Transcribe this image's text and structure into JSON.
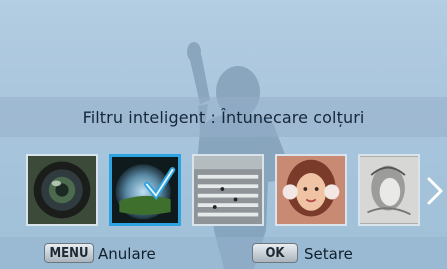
{
  "title": "Filtru inteligent : Întunecare colțuri",
  "thumbnails": [
    {
      "name": "fisheye",
      "selected": false
    },
    {
      "name": "vignette",
      "selected": true
    },
    {
      "name": "miniature",
      "selected": false
    },
    {
      "name": "soft-focus",
      "selected": false
    },
    {
      "name": "sketch",
      "selected": false
    }
  ],
  "footer": {
    "menu_key": "MENU",
    "menu_label": "Anulare",
    "ok_key": "OK",
    "ok_label": "Setare"
  },
  "colors": {
    "selection": "#2da4e1",
    "bar": "#96b2cd"
  }
}
